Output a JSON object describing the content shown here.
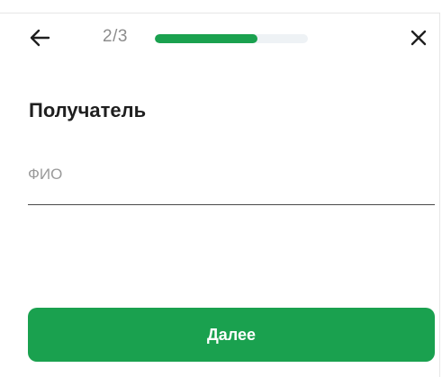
{
  "header": {
    "back_icon": "arrow-left-icon",
    "step": "2/3",
    "progress": 0.67,
    "close_icon": "close-icon",
    "accent_color": "#1aa14f"
  },
  "form": {
    "title": "Получатель",
    "name_field": {
      "placeholder": "ФИО",
      "value": ""
    }
  },
  "actions": {
    "next_label": "Далее"
  }
}
